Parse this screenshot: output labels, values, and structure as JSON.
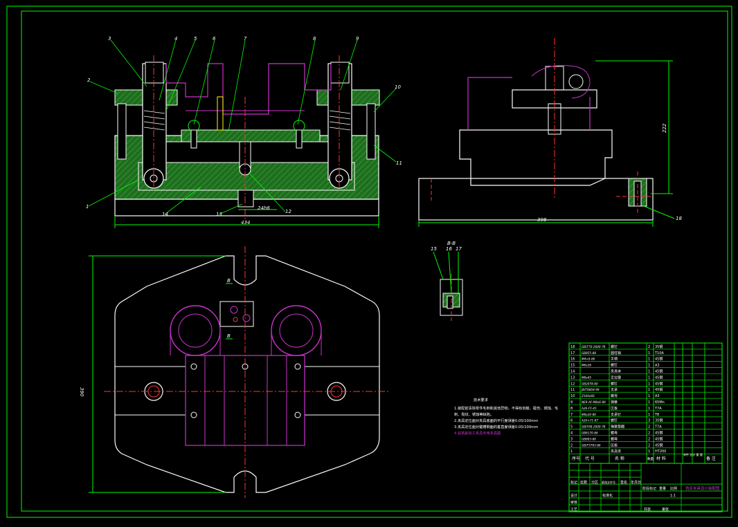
{
  "drawing": {
    "colors": {
      "background": "#000000",
      "border": "#00ff00",
      "outline": "#ffffff",
      "hatch": "#2e8b2e",
      "part": "#cc33cc",
      "centerline": "#ff3333",
      "dimension": "#00ff00",
      "leader": "#00ff00",
      "text": "#ffffff"
    },
    "front_view": {
      "balloons": [
        "3",
        "4",
        "5",
        "6",
        "7",
        "8",
        "9",
        "2",
        "10",
        "11",
        "1",
        "14",
        "13",
        "12"
      ],
      "dimensions": {
        "overall_width": "434",
        "slot_width": "24h6"
      }
    },
    "side_view": {
      "dimensions": {
        "height": "222",
        "width": "398"
      },
      "balloons": [
        "18"
      ]
    },
    "plan_view": {
      "dimensions": {
        "height": "390"
      },
      "section_marks": [
        "B",
        "B"
      ]
    },
    "section_view": {
      "title": "B-B",
      "balloons": [
        "15",
        "16",
        "17"
      ]
    },
    "notes": {
      "heading": "技术要求",
      "lines": [
        "1.装配前清除零件毛刺和其他异物，不得有划痕、碰伤、锈蚀、毛",
        "  刺、裂纹、锈蚀等缺陷。",
        "2.夹具定位面对夹具底面的平行度误差0.05/100mm",
        "3.夹具定位面对键槽侧面的垂直度误差0.05/100mm",
        "4.钻铣削加工夹具专用夹具图"
      ]
    },
    "bom": {
      "rows": [
        {
          "no": "18",
          "code": "GB/T70-2000-78",
          "name": "螺钉",
          "qty": "2",
          "mat": "35钢"
        },
        {
          "no": "17",
          "code": "GB855-88",
          "name": "圆柱销",
          "qty": "1",
          "mat": "T10A"
        },
        {
          "no": "16",
          "code": "M4×6-86",
          "name": "手柄",
          "qty": "1",
          "mat": "45钢"
        },
        {
          "no": "15",
          "code": "M6x36",
          "name": "螺钉",
          "qty": "1",
          "mat": "A3"
        },
        {
          "no": "14",
          "code": "",
          "name": "夹具体",
          "qty": "1",
          "mat": "45钢"
        },
        {
          "no": "13",
          "code": "M8x45",
          "name": "定位键",
          "qty": "1",
          "mat": "45钢"
        },
        {
          "no": "12",
          "code": "GB2078-80",
          "name": "螺钉",
          "qty": "1",
          "mat": "45钢"
        },
        {
          "no": "11",
          "code": "JB/T8004-99",
          "name": "支承",
          "qty": "1",
          "mat": "45钢"
        },
        {
          "no": "10",
          "code": "Z100x60",
          "name": "螺母",
          "qty": "1",
          "mat": "A3"
        },
        {
          "no": "9",
          "code": "NE9-AF-M8x6-89",
          "name": "弹簧",
          "qty": "1",
          "mat": "65Mn"
        },
        {
          "no": "8",
          "code": "A26-F5-45",
          "name": "压板",
          "qty": "1",
          "mat": "T7A"
        },
        {
          "no": "7",
          "code": "M8x20-86",
          "name": "支承钉",
          "qty": "1",
          "mat": "T8"
        },
        {
          "no": "6",
          "code": "A20×71-87",
          "name": "螺钉",
          "qty": "3",
          "mat": "35钢"
        },
        {
          "no": "5",
          "code": "GB/T68-2000-78",
          "name": "弹簧垫圈",
          "qty": "2",
          "mat": "T7A"
        },
        {
          "no": "4",
          "code": "GB6170-86",
          "name": "螺母",
          "qty": "2",
          "mat": "45钢"
        },
        {
          "no": "3",
          "code": "GB893-86",
          "name": "螺母",
          "qty": "2",
          "mat": "45钢"
        },
        {
          "no": "2",
          "code": "GB/T5783-86",
          "name": "压板",
          "qty": "2",
          "mat": "45钢"
        },
        {
          "no": "1",
          "code": "",
          "name": "夹具体",
          "qty": "1",
          "mat": "HT200"
        }
      ],
      "header": {
        "no": "序号",
        "code": "代 号",
        "name": "名 称",
        "qty": "数量",
        "mat": "材 料",
        "weight": "单件 总计 重 量",
        "remark": "备 注"
      }
    },
    "title_block": {
      "drawing_name": "铣床夹具设计装配图",
      "labels": [
        "标记",
        "处数",
        "分区",
        "更改文件号",
        "签名",
        "年月日",
        "设计",
        "标准化",
        "审核",
        "工艺",
        "阶段标记",
        "重量",
        "比例",
        "共张",
        "第张"
      ],
      "scale": "1:1"
    }
  }
}
